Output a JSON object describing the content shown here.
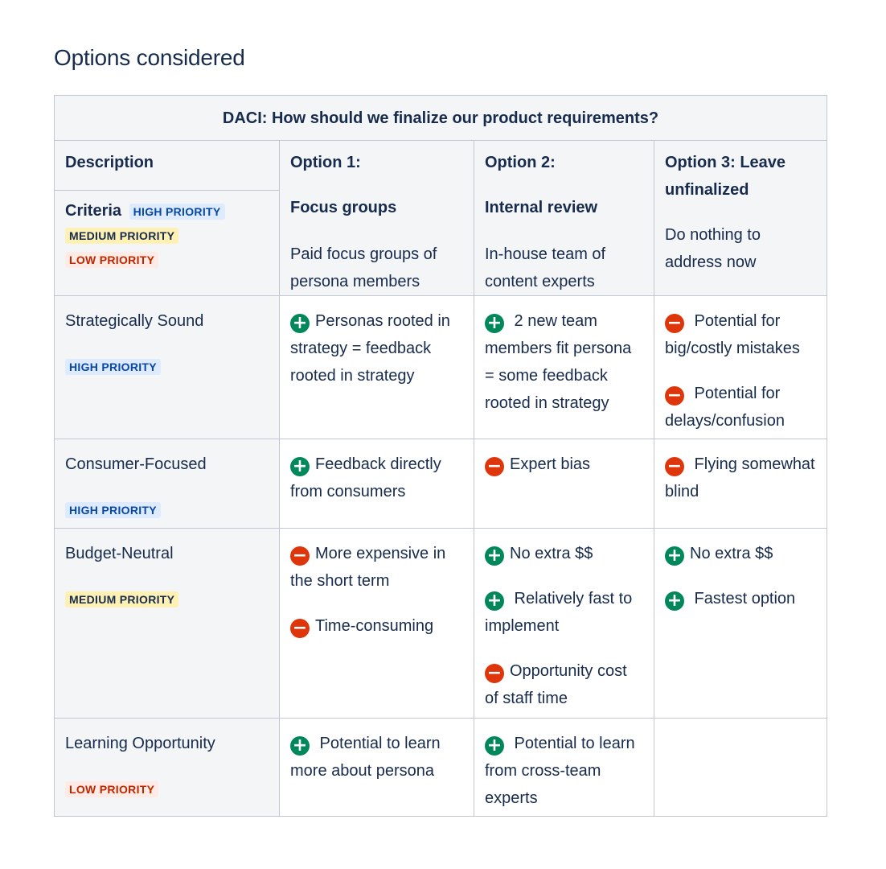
{
  "page": {
    "heading": "Options considered"
  },
  "table": {
    "title": "DACI: How should we finalize our product requirements?",
    "description_label": "Description",
    "criteria_label": "Criteria",
    "criteria_badges": [
      "HIGH PRIORITY",
      "MEDIUM PRIORITY",
      "LOW PRIORITY"
    ],
    "options": [
      {
        "number": "Option 1:",
        "name": "Focus groups",
        "description": "Paid focus groups of persona members"
      },
      {
        "number": "Option 2:",
        "name": "Internal review",
        "description": "In-house team of content experts"
      },
      {
        "number": "Option 3: Leave unfinalized",
        "name": "",
        "description": "Do nothing to address now"
      }
    ],
    "rows": [
      {
        "label": "Strategically Sound",
        "priority": "HIGH PRIORITY",
        "cells": [
          [
            {
              "sign": "plus",
              "text": "Personas rooted in strategy = feedback rooted in strategy"
            }
          ],
          [
            {
              "sign": "plus",
              "text": " 2 new team members fit persona = some feedback rooted in strategy"
            }
          ],
          [
            {
              "sign": "minus",
              "text": " Potential for big/costly mistakes"
            },
            {
              "sign": "minus",
              "text": " Potential for delays/confusion"
            }
          ]
        ]
      },
      {
        "label": "Consumer-Focused",
        "priority": "HIGH PRIORITY",
        "cells": [
          [
            {
              "sign": "plus",
              "text": "Feedback directly from consumers"
            }
          ],
          [
            {
              "sign": "minus",
              "text": "Expert bias"
            }
          ],
          [
            {
              "sign": "minus",
              "text": " Flying somewhat blind"
            }
          ]
        ]
      },
      {
        "label": "Budget-Neutral",
        "priority": "MEDIUM PRIORITY",
        "cells": [
          [
            {
              "sign": "minus",
              "text": "More expensive in the short term"
            },
            {
              "sign": "minus",
              "text": "Time-consuming"
            }
          ],
          [
            {
              "sign": "plus",
              "text": "No extra $$"
            },
            {
              "sign": "plus",
              "text": " Relatively fast to implement"
            },
            {
              "sign": "minus",
              "text": "Opportunity cost of staff time"
            }
          ],
          [
            {
              "sign": "plus",
              "text": "No extra $$"
            },
            {
              "sign": "plus",
              "text": " Fastest option"
            }
          ]
        ]
      },
      {
        "label": "Learning Opportunity",
        "priority": "LOW PRIORITY",
        "cells": [
          [
            {
              "sign": "plus",
              "text": " Potential to learn more about persona"
            }
          ],
          [
            {
              "sign": "plus",
              "text": " Potential to learn from cross-team experts"
            }
          ],
          []
        ]
      }
    ]
  },
  "icons": {
    "plus": "plus-circle-icon",
    "minus": "minus-circle-icon"
  },
  "colors": {
    "plus": "#00875a",
    "minus": "#de350b",
    "header_bg": "#f4f5f7",
    "border": "#c1c7d0",
    "text": "#172b4d"
  }
}
